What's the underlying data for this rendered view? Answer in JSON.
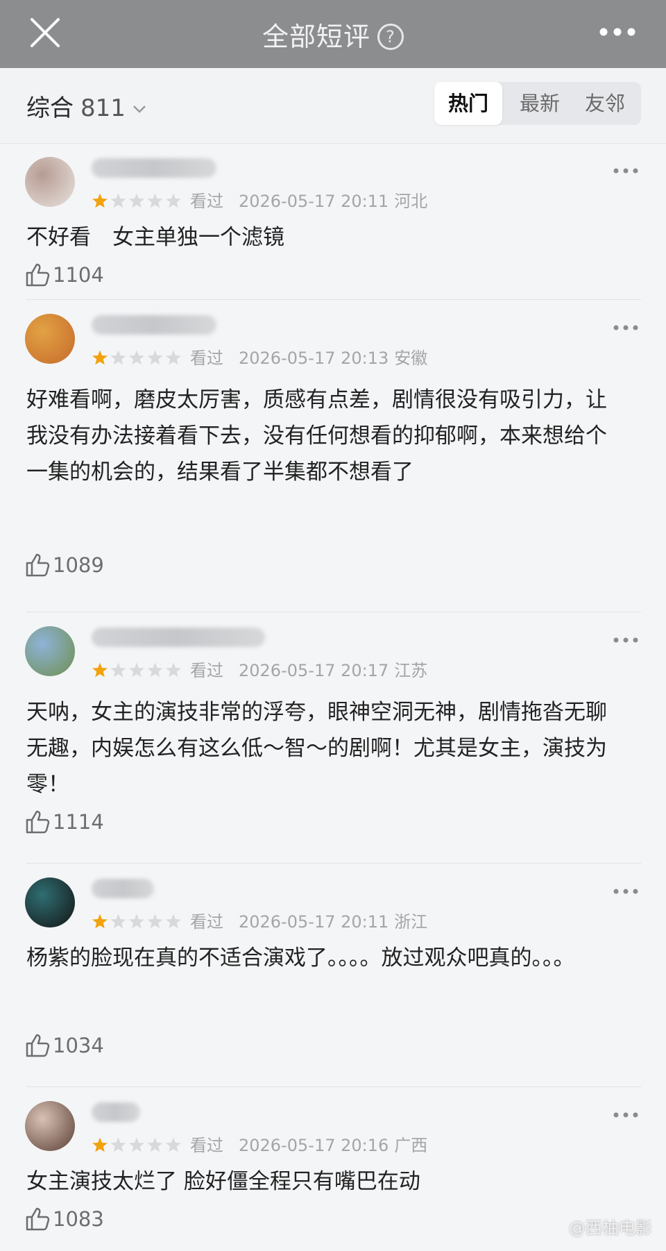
{
  "header": {
    "title": "全部短评",
    "help_icon": "question-circle-icon"
  },
  "filter": {
    "sort_label": "综合",
    "count": "811",
    "tabs": [
      {
        "label": "热门",
        "active": true
      },
      {
        "label": "最新",
        "active": false
      },
      {
        "label": "友邻",
        "active": false
      }
    ]
  },
  "reviews": [
    {
      "rating": 1,
      "status": "看过",
      "date": "2026-05-17 20:11",
      "location": "河北",
      "text": "不好看　女主单独一个滤镜",
      "likes": "1104",
      "avatar_colors": [
        "#b69c93",
        "#e9e2de"
      ]
    },
    {
      "rating": 1,
      "status": "看过",
      "date": "2026-05-17 20:13",
      "location": "安徽",
      "text": "好难看啊，磨皮太厉害，质感有点差，剧情很没有吸引力，让我没有办法接着看下去，没有任何想看的抑郁啊，本来想给个一集的机会的，结果看了半集都不想看了",
      "likes": "1089",
      "avatar_colors": [
        "#e2a244",
        "#c66a2b"
      ]
    },
    {
      "rating": 1,
      "status": "看过",
      "date": "2026-05-17 20:17",
      "location": "江苏",
      "text": "天呐，女主的演技非常的浮夸，眼神空洞无神，剧情拖沓无聊无趣，内娱怎么有这么低～智～的剧啊！尤其是女主，演技为零！",
      "likes": "1114",
      "avatar_colors": [
        "#8fb3d9",
        "#6d8f4e"
      ]
    },
    {
      "rating": 1,
      "status": "看过",
      "date": "2026-05-17 20:11",
      "location": "浙江",
      "text": "杨紫的脸现在真的不适合演戏了。。。。放过观众吧真的。。。",
      "likes": "1034",
      "avatar_colors": [
        "#2f6e72",
        "#141414"
      ]
    },
    {
      "rating": 1,
      "status": "看过",
      "date": "2026-05-17 20:16",
      "location": "广西",
      "text": "女主演技太烂了 脸好僵全程只有嘴巴在动",
      "likes": "1083",
      "avatar_colors": [
        "#d9c2b5",
        "#5a3e33"
      ]
    }
  ],
  "watermark": "@西柚电影",
  "colors": {
    "star_on": "#f2a20c",
    "star_off": "#d8d9db",
    "topbar": "#8c8d8f"
  }
}
